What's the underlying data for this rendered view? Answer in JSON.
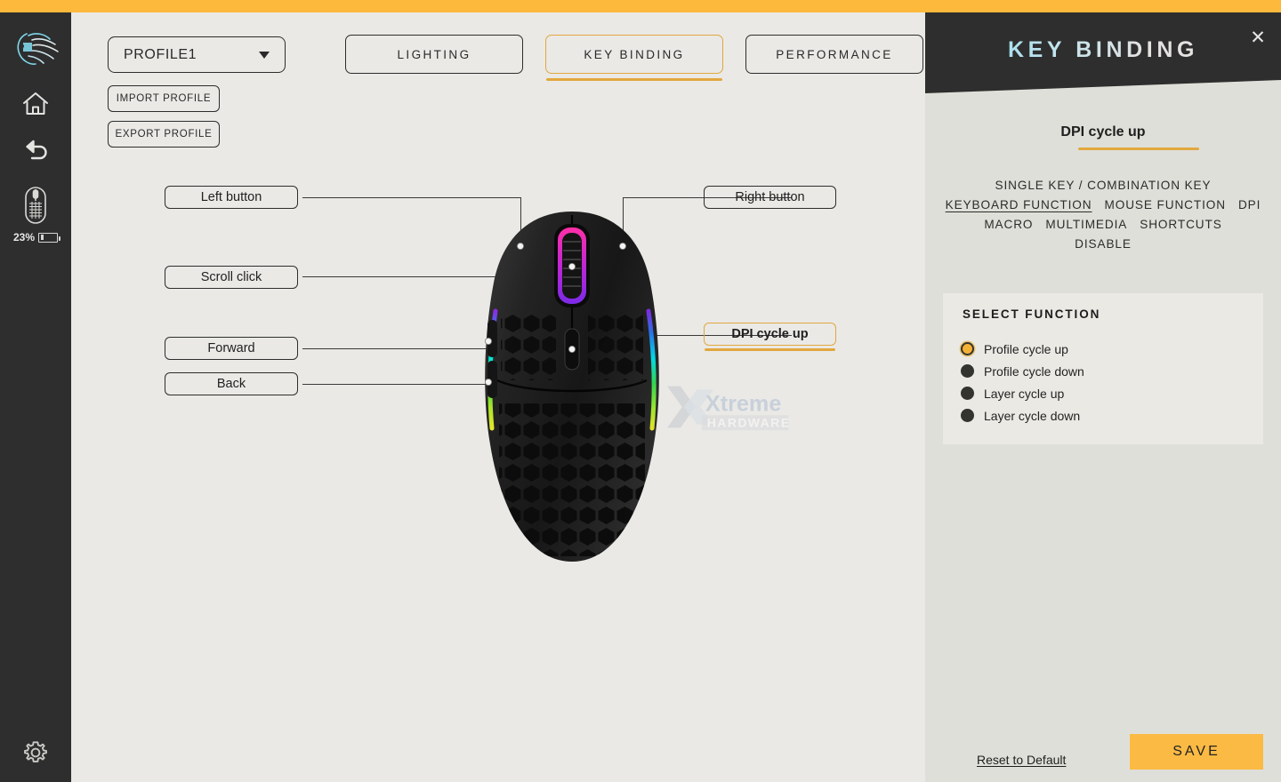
{
  "theme": {
    "accent": "#FDB93B",
    "accent_border": "#E2A73E",
    "sidebar_bg": "#2E2E2E",
    "main_bg": "#EAE9E6",
    "panel_bg": "#DFDFD9",
    "panel_card_bg": "#EAE9E4",
    "logo_color": "#7FD7EA",
    "save_bg": "#FBBA44"
  },
  "sidebar": {
    "logo_name": "glorious-logo",
    "items": [
      {
        "name": "home-icon",
        "label": "Home"
      },
      {
        "name": "undo-icon",
        "label": "Back"
      },
      {
        "name": "mouse-device-icon",
        "label": "Mouse"
      },
      {
        "name": "gear-icon",
        "label": "Settings"
      }
    ],
    "battery": {
      "percent_label": "23%",
      "percent_value": 23
    }
  },
  "toolbar": {
    "profile_value": "PROFILE1",
    "profile_options": [
      "PROFILE1"
    ],
    "import_label": "IMPORT PROFILE",
    "export_label": "EXPORT PROFILE"
  },
  "tabs": [
    {
      "label": "LIGHTING",
      "active": false
    },
    {
      "label": "KEY BINDING",
      "active": true
    },
    {
      "label": "PERFORMANCE",
      "active": false
    }
  ],
  "diagram": {
    "watermark": {
      "line1": "Xtreme",
      "line2": "HARDWARE"
    },
    "callouts": [
      {
        "name": "callout-left-button",
        "label": "Left button",
        "highlight": false
      },
      {
        "name": "callout-scroll-click",
        "label": "Scroll click",
        "highlight": false
      },
      {
        "name": "callout-forward",
        "label": "Forward",
        "highlight": false
      },
      {
        "name": "callout-back",
        "label": "Back",
        "highlight": false
      },
      {
        "name": "callout-right-button",
        "label": "Right button",
        "highlight": false
      },
      {
        "name": "callout-dpi-cycle-up",
        "label": "DPI cycle up",
        "highlight": true
      }
    ]
  },
  "panel": {
    "title": "KEY BINDING",
    "close_label": "✕",
    "binding_name": "DPI cycle up",
    "categories": [
      {
        "label": "SINGLE KEY / COMBINATION KEY",
        "active": false,
        "full": true
      },
      {
        "label": "KEYBOARD FUNCTION",
        "active": true,
        "full": false
      },
      {
        "label": "MOUSE FUNCTION",
        "active": false,
        "full": false
      },
      {
        "label": "DPI",
        "active": false,
        "full": false
      },
      {
        "label": "MACRO",
        "active": false,
        "full": false
      },
      {
        "label": "MULTIMEDIA",
        "active": false,
        "full": false
      },
      {
        "label": "SHORTCUTS",
        "active": false,
        "full": false
      },
      {
        "label": "DISABLE",
        "active": false,
        "full": true
      }
    ],
    "select_function": {
      "title": "SELECT FUNCTION",
      "options": [
        {
          "label": "Profile cycle up",
          "selected": true
        },
        {
          "label": "Profile cycle down",
          "selected": false
        },
        {
          "label": "Layer cycle up",
          "selected": false
        },
        {
          "label": "Layer cycle down",
          "selected": false
        }
      ]
    },
    "reset_label": "Reset to Default",
    "save_label": "SAVE"
  }
}
